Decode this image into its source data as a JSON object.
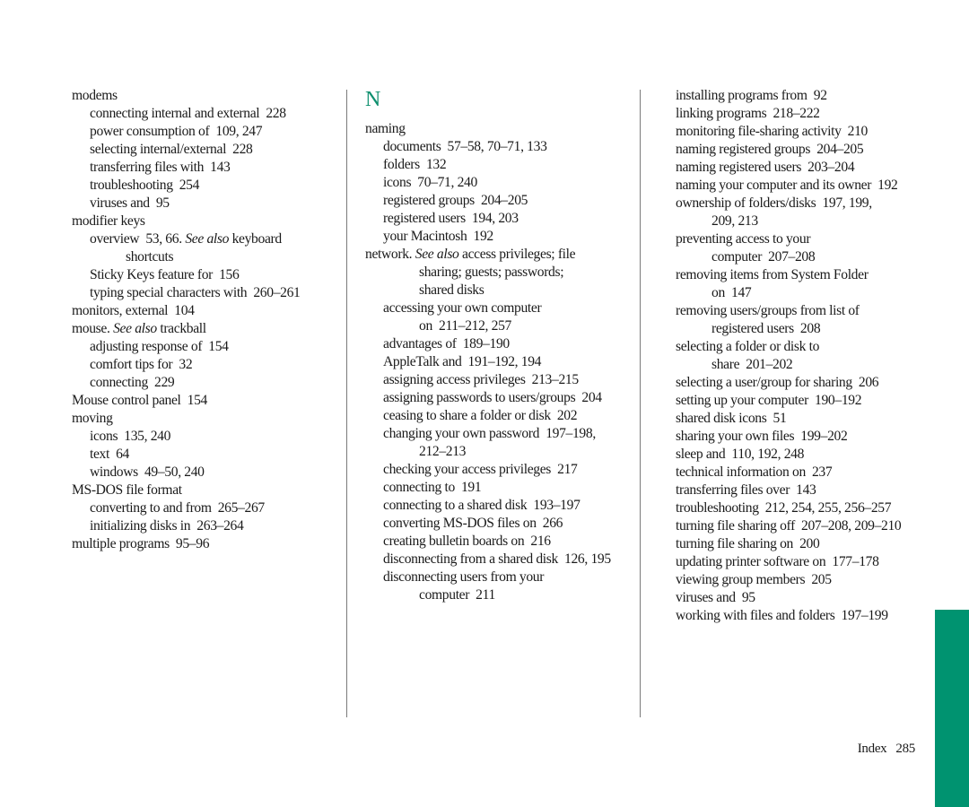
{
  "page": {
    "section_letter": "N",
    "footer_label": "Index",
    "page_number": "285",
    "accent_color": "#009370"
  },
  "columns": [
    {
      "entries": [
        {
          "level": 0,
          "text": "modems"
        },
        {
          "level": 1,
          "text": "connecting internal and external  228"
        },
        {
          "level": 1,
          "text": "power consumption of  109, 247"
        },
        {
          "level": 1,
          "text": "selecting internal/external  228"
        },
        {
          "level": 1,
          "text": "transferring files with  143"
        },
        {
          "level": 1,
          "text": "troubleshooting  254"
        },
        {
          "level": 1,
          "text": "viruses and  95"
        },
        {
          "level": 0,
          "text": "modifier keys"
        },
        {
          "level": 1,
          "text": "overview  53, 66. ",
          "see_also": "See also",
          "after": " keyboard"
        },
        {
          "level": "cont1",
          "text": "shortcuts"
        },
        {
          "level": 1,
          "text": "Sticky Keys feature for  156"
        },
        {
          "level": 1,
          "text": "typing special characters with  260–261"
        },
        {
          "level": 0,
          "text": "monitors, external  104"
        },
        {
          "level": 0,
          "text": "mouse. ",
          "see_also": "See also",
          "after": " trackball"
        },
        {
          "level": 1,
          "text": "adjusting response of  154"
        },
        {
          "level": 1,
          "text": "comfort tips for  32"
        },
        {
          "level": 1,
          "text": "connecting  229"
        },
        {
          "level": 0,
          "text": "Mouse control panel  154"
        },
        {
          "level": 0,
          "text": "moving"
        },
        {
          "level": 1,
          "text": "icons  135, 240"
        },
        {
          "level": 1,
          "text": "text  64"
        },
        {
          "level": 1,
          "text": "windows  49–50, 240"
        },
        {
          "level": 0,
          "text": "MS-DOS file format"
        },
        {
          "level": 1,
          "text": "converting to and from  265–267"
        },
        {
          "level": 1,
          "text": "initializing disks in  263–264"
        },
        {
          "level": 0,
          "text": "multiple programs  95–96"
        }
      ]
    },
    {
      "entries": [
        {
          "level": 0,
          "text": "naming"
        },
        {
          "level": 1,
          "text": "documents  57–58, 70–71, 133"
        },
        {
          "level": 1,
          "text": "folders  132"
        },
        {
          "level": 1,
          "text": "icons  70–71, 240"
        },
        {
          "level": 1,
          "text": "registered groups  204–205"
        },
        {
          "level": 1,
          "text": "registered users  194, 203"
        },
        {
          "level": 1,
          "text": "your Macintosh  192"
        },
        {
          "level": 0,
          "text": "network. ",
          "see_also": "See also",
          "after": " access privileges; file"
        },
        {
          "level": "cont0",
          "text": "sharing; guests; passwords;"
        },
        {
          "level": "cont0",
          "text": "shared disks"
        },
        {
          "level": 1,
          "text": "accessing your own computer"
        },
        {
          "level": "cont1",
          "text": "on  211–212, 257"
        },
        {
          "level": 1,
          "text": "advantages of  189–190"
        },
        {
          "level": 1,
          "text": "AppleTalk and  191–192, 194"
        },
        {
          "level": 1,
          "text": "assigning access privileges  213–215"
        },
        {
          "level": 1,
          "text": "assigning passwords to users/groups  204"
        },
        {
          "level": 1,
          "text": "ceasing to share a folder or disk  202"
        },
        {
          "level": 1,
          "text": "changing your own password  197–198,"
        },
        {
          "level": "cont1",
          "text": "212–213"
        },
        {
          "level": 1,
          "text": "checking your access privileges  217"
        },
        {
          "level": 1,
          "text": "connecting to  191"
        },
        {
          "level": 1,
          "text": "connecting to a shared disk  193–197"
        },
        {
          "level": 1,
          "text": "converting MS-DOS files on  266"
        },
        {
          "level": 1,
          "text": "creating bulletin boards on  216"
        },
        {
          "level": 1,
          "text": "disconnecting from a shared disk  126, 195"
        },
        {
          "level": 1,
          "text": "disconnecting users from your"
        },
        {
          "level": "cont1",
          "text": "computer  211"
        }
      ]
    },
    {
      "entries": [
        {
          "level": 0,
          "text": "installing programs from  92"
        },
        {
          "level": 0,
          "text": "linking programs  218–222"
        },
        {
          "level": 0,
          "text": "monitoring file-sharing activity  210"
        },
        {
          "level": 0,
          "text": "naming registered groups  204–205"
        },
        {
          "level": 0,
          "text": "naming registered users  203–204"
        },
        {
          "level": 0,
          "text": "naming your computer and its owner  192"
        },
        {
          "level": 0,
          "text": "ownership of folders/disks  197, 199,"
        },
        {
          "level": "cont3",
          "text": "209, 213"
        },
        {
          "level": 0,
          "text": "preventing access to your"
        },
        {
          "level": "cont3",
          "text": "computer  207–208"
        },
        {
          "level": 0,
          "text": "removing items from System Folder"
        },
        {
          "level": "cont3",
          "text": "on  147"
        },
        {
          "level": 0,
          "text": "removing users/groups from list of"
        },
        {
          "level": "cont3",
          "text": "registered users  208"
        },
        {
          "level": 0,
          "text": "selecting a folder or disk to"
        },
        {
          "level": "cont3",
          "text": "share  201–202"
        },
        {
          "level": 0,
          "text": "selecting a user/group for sharing  206"
        },
        {
          "level": 0,
          "text": "setting up your computer  190–192"
        },
        {
          "level": 0,
          "text": "shared disk icons  51"
        },
        {
          "level": 0,
          "text": "sharing your own files  199–202"
        },
        {
          "level": 0,
          "text": "sleep and  110, 192, 248"
        },
        {
          "level": 0,
          "text": "technical information on  237"
        },
        {
          "level": 0,
          "text": "transferring files over  143"
        },
        {
          "level": 0,
          "text": "troubleshooting  212, 254, 255, 256–257"
        },
        {
          "level": 0,
          "text": "turning file sharing off  207–208, 209–210"
        },
        {
          "level": 0,
          "text": "turning file sharing on  200"
        },
        {
          "level": 0,
          "text": "updating printer software on  177–178"
        },
        {
          "level": 0,
          "text": "viewing group members  205"
        },
        {
          "level": 0,
          "text": "viruses and  95"
        },
        {
          "level": 0,
          "text": "working with files and folders  197–199"
        }
      ]
    }
  ]
}
